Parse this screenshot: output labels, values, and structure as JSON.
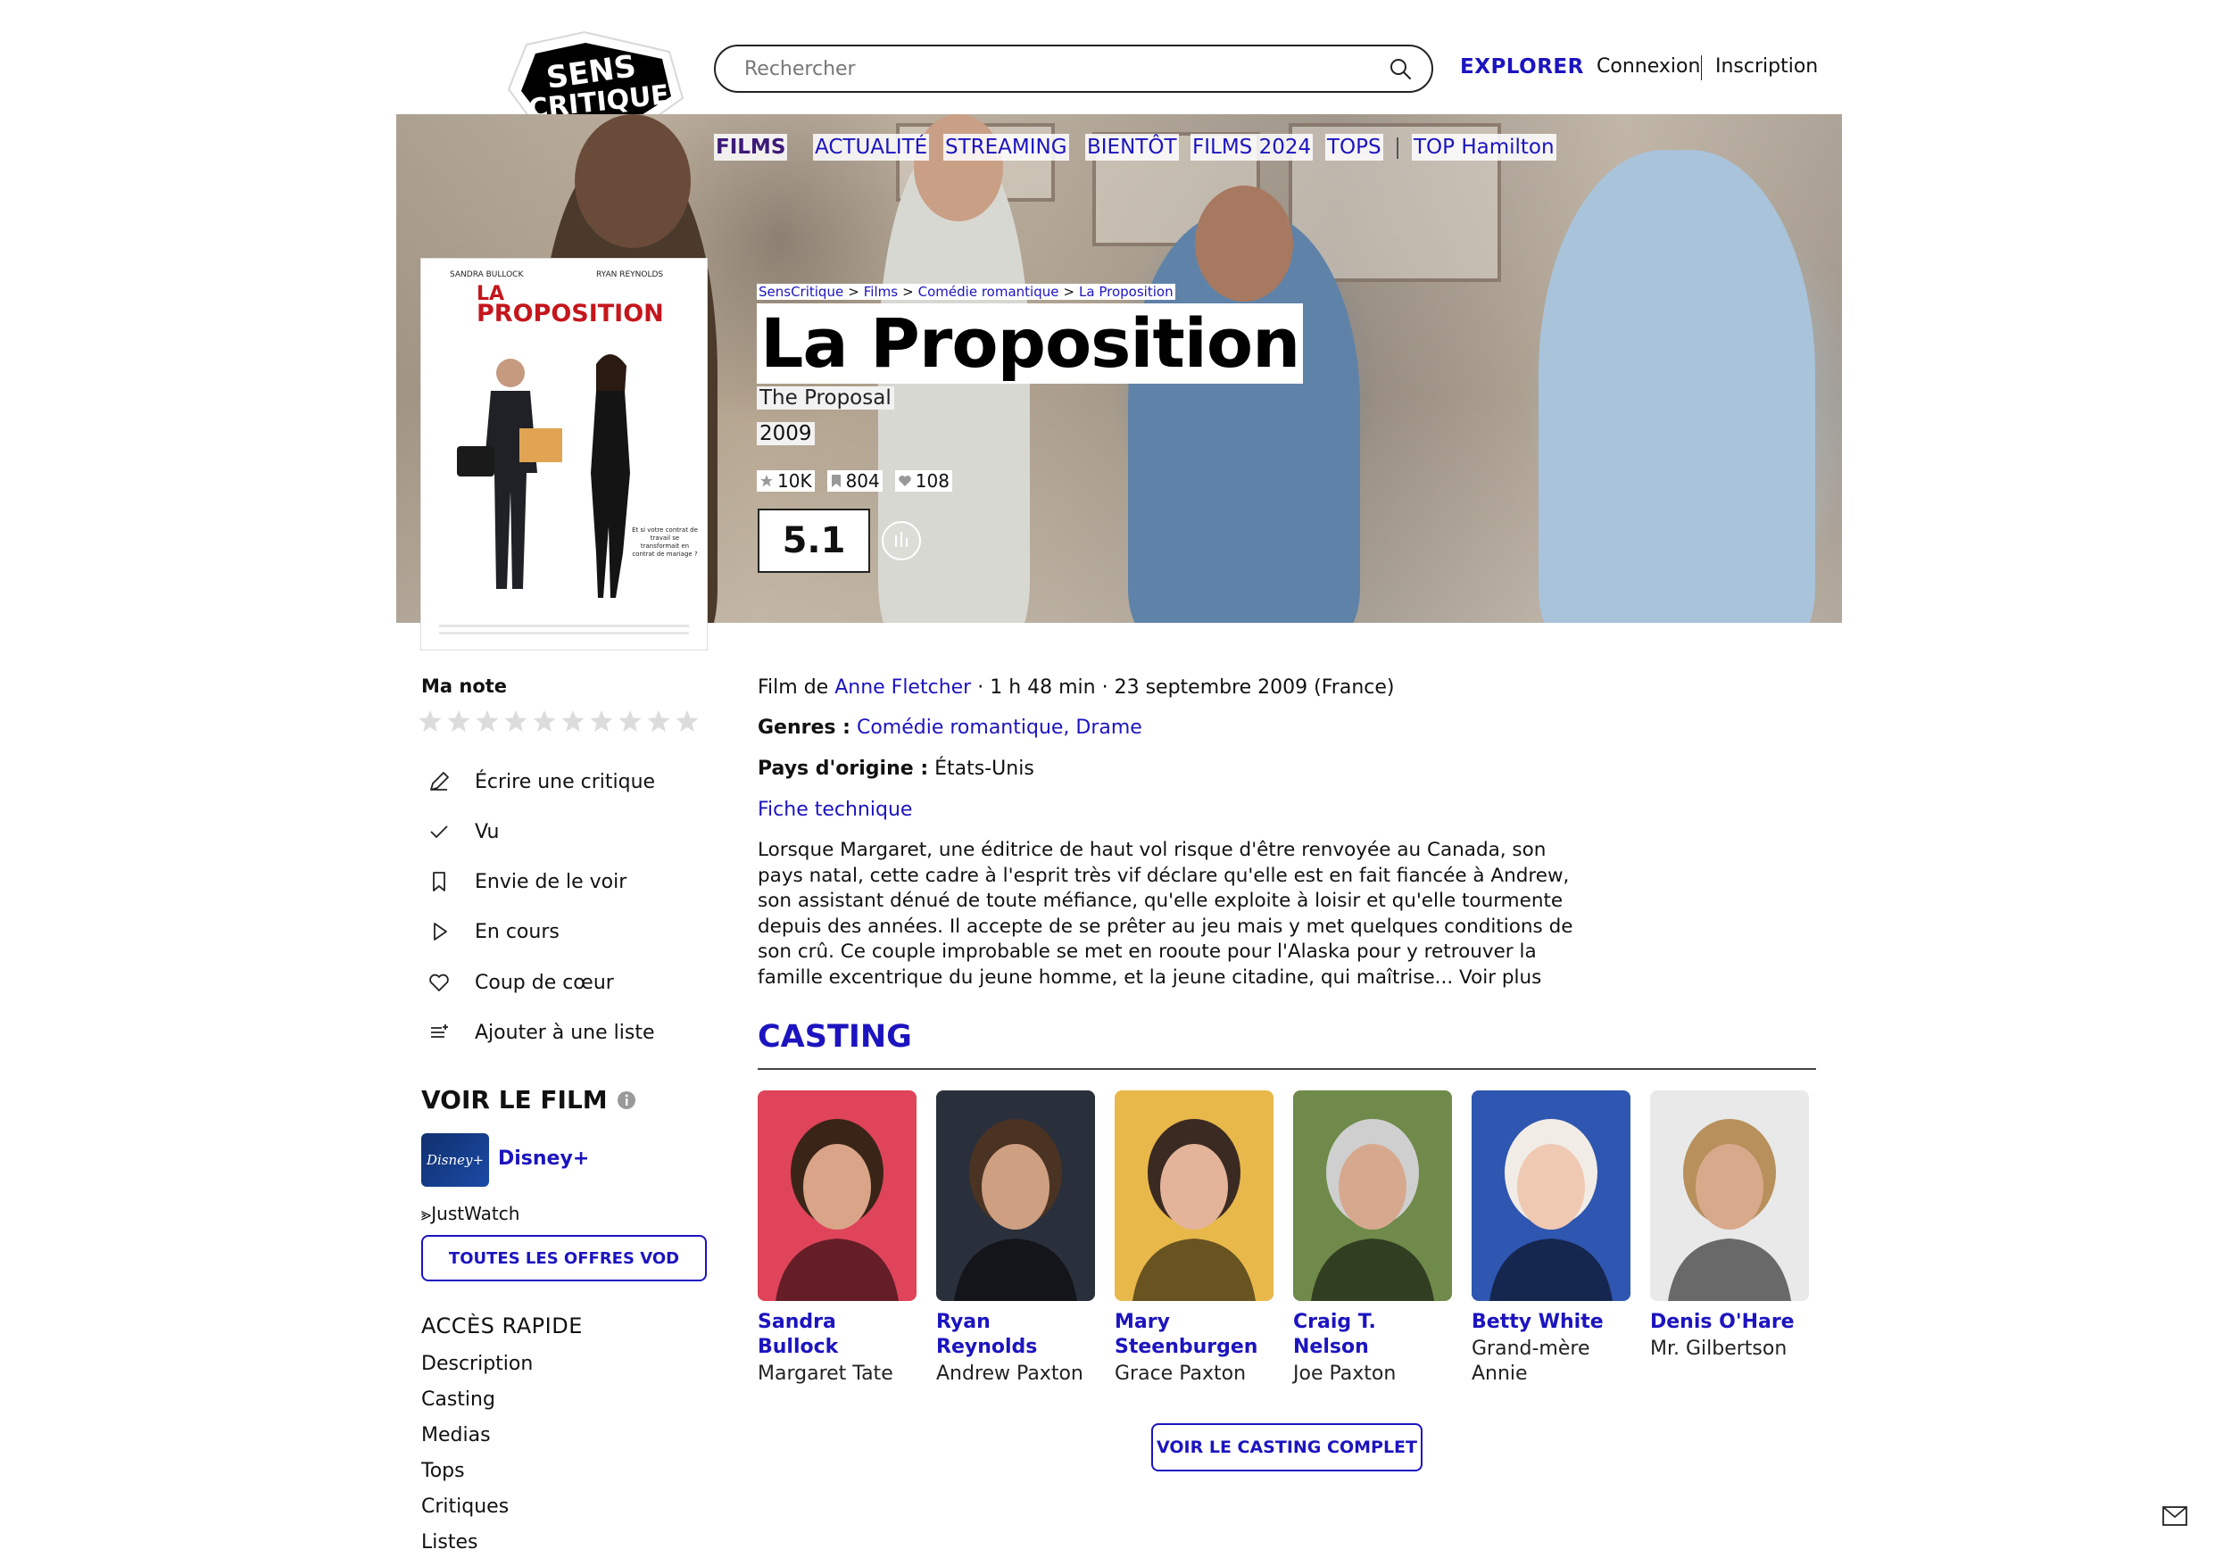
{
  "header": {
    "logo_line1": "SENS",
    "logo_line2": "CRITIQUE",
    "search_placeholder": "Rechercher",
    "explore_label": "EXPLORER",
    "login_label": "Connexion",
    "signup_label": "Inscription"
  },
  "menu": {
    "items": [
      "FILMS",
      "ACTUALITÉ",
      "STREAMING",
      "BIENTÔT",
      "FILMS 2024",
      "TOPS",
      "TOP Hamilton"
    ],
    "active_index": 0
  },
  "poster": {
    "actor1": "SANDRA BULLOCK",
    "actor2": "RYAN REYNOLDS",
    "title_line1": "LA",
    "title_line2": "PROPOSITION",
    "tagline": "Et si votre contrat de travail se transformait en contrat de mariage ?"
  },
  "breadcrumb": [
    "SensCritique",
    "Films",
    "Comédie romantique",
    "La Proposition"
  ],
  "movie": {
    "title": "La Proposition",
    "original_title": "The Proposal",
    "year": "2009",
    "stats": {
      "ratings": "10K",
      "wishlist": "804",
      "favorites": "108"
    },
    "score": "5.1",
    "credits_prefix": "Film de",
    "director": "Anne Fletcher",
    "credits_suffix": " · 1 h 48 min · 23 septembre 2009 (France)",
    "genres_label": "Genres :",
    "genres": "Comédie romantique, Drame",
    "country_label": "Pays d'origine :",
    "country": "États-Unis",
    "fiche_label": "Fiche technique",
    "synopsis": "Lorsque Margaret, une éditrice de haut vol risque d'être renvoyée au Canada, son pays natal, cette cadre à l'esprit très vif déclare qu'elle est en fait fiancée à Andrew, son assistant dénué de toute méfiance, qu'elle exploite à loisir et qu'elle tourmente depuis des années.  Il accepte de se prêter au jeu mais y met quelques conditions de son crû.  Ce couple improbable se met en rooute pour l'Alaska pour y retrouver la famille excentrique du jeune homme, et la jeune citadine, qui maîtrise...",
    "voir_plus": "Voir plus"
  },
  "sidebar": {
    "ma_note_label": "Ma note",
    "star_count": 10,
    "actions": [
      "Écrire une critique",
      "Vu",
      "Envie de le voir",
      "En cours",
      "Coup de cœur",
      "Ajouter à une liste"
    ],
    "voir_le_film_title": "VOIR LE FILM",
    "provider_name": "Disney+",
    "provider_logo_text": "Disney+",
    "justwatch_label": "JustWatch",
    "vod_button_label": "TOUTES LES OFFRES VOD",
    "quick_access_title": "ACCÈS RAPIDE",
    "quick_links": [
      "Description",
      "Casting",
      "Medias",
      "Tops",
      "Critiques",
      "Listes"
    ]
  },
  "casting": {
    "title": "CASTING",
    "members": [
      {
        "name": "Sandra Bullock",
        "role": "Margaret Tate",
        "bg": "#e0445a",
        "skin": "#d9a487",
        "hair": "#3a2418"
      },
      {
        "name": "Ryan Reynolds",
        "role": "Andrew Paxton",
        "bg": "#2a2f3c",
        "skin": "#cf9f82",
        "hair": "#4a3323"
      },
      {
        "name": "Mary Steenburgen",
        "role": "Grace Paxton",
        "bg": "#e8b84a",
        "skin": "#e3b49a",
        "hair": "#3b2a22"
      },
      {
        "name": "Craig T. Nelson",
        "role": "Joe Paxton",
        "bg": "#6f8a4a",
        "skin": "#d6a98f",
        "hair": "#cfcfcf"
      },
      {
        "name": "Betty White",
        "role": "Grand-mère Annie",
        "bg": "#2f56b0",
        "skin": "#f0c9b3",
        "hair": "#f1ece6"
      },
      {
        "name": "Denis O'Hare",
        "role": "Mr. Gilbertson",
        "bg": "#e9e9ea",
        "skin": "#d9a98c",
        "hair": "#b7905c"
      }
    ],
    "full_casting_label": "VOIR LE CASTING COMPLET"
  }
}
